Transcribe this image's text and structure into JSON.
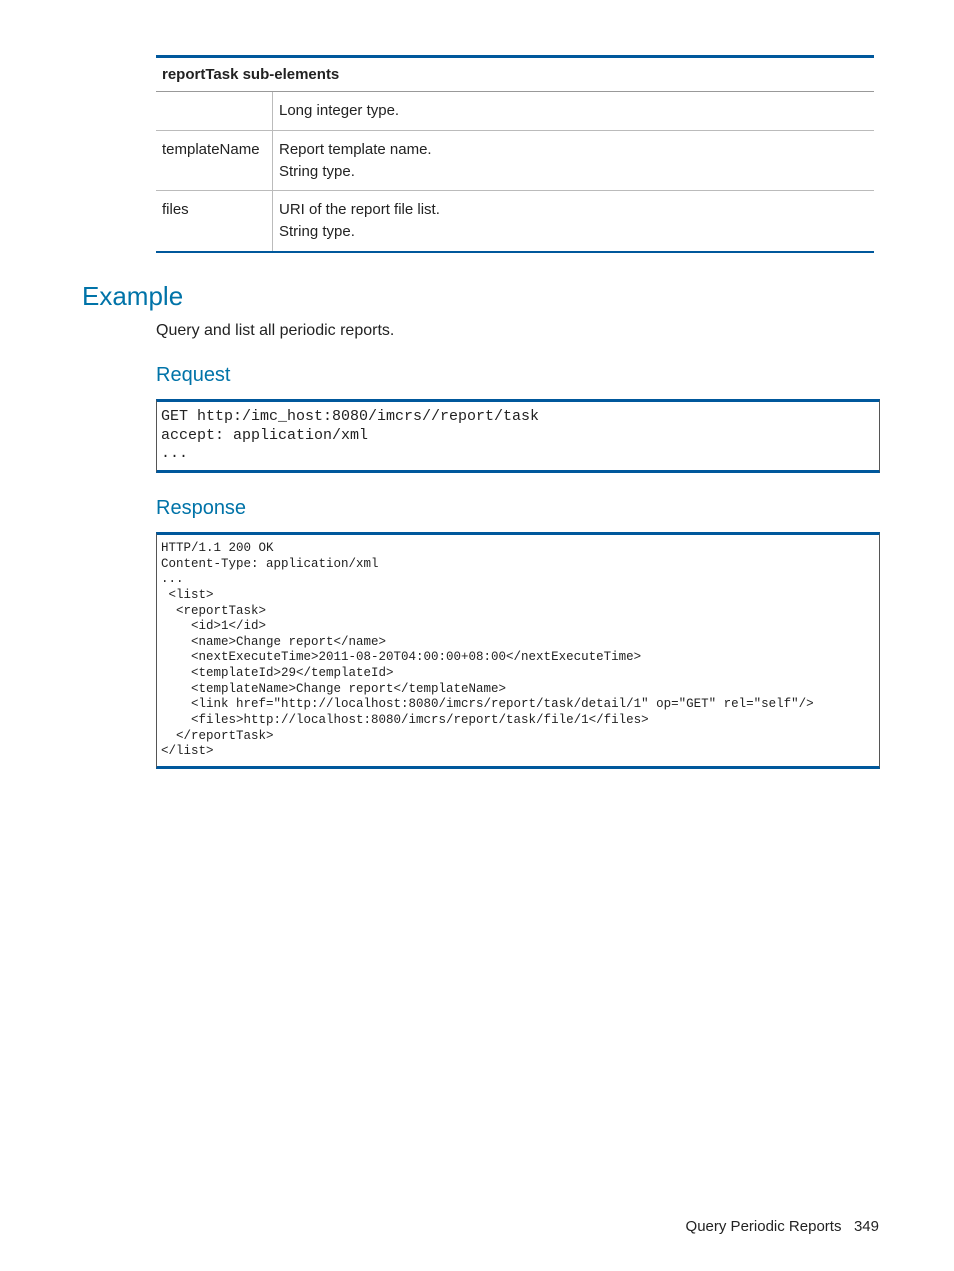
{
  "table": {
    "header": "reportTask sub-elements",
    "rows": [
      {
        "c1": "",
        "c2": "Long integer type."
      },
      {
        "c1": "templateName",
        "c2": "Report template name.\nString type."
      },
      {
        "c1": "files",
        "c2": "URI of the report file list.\nString type."
      }
    ]
  },
  "example": {
    "heading": "Example",
    "intro": "Query and list all periodic reports.",
    "request_heading": "Request",
    "request_code": "GET http:/imc_host:8080/imcrs//report/task\naccept: application/xml\n...",
    "response_heading": "Response",
    "response_code": "HTTP/1.1 200 OK\nContent-Type: application/xml\n...\n <list>\n  <reportTask>\n    <id>1</id>\n    <name>Change report</name>\n    <nextExecuteTime>2011-08-20T04:00:00+08:00</nextExecuteTime>\n    <templateId>29</templateId>\n    <templateName>Change report</templateName>\n    <link href=\"http://localhost:8080/imcrs/report/task/detail/1\" op=\"GET\" rel=\"self\"/>\n    <files>http://localhost:8080/imcrs/report/task/file/1</files>\n  </reportTask>\n</list>"
  },
  "footer": {
    "title": "Query Periodic Reports",
    "page": "349"
  }
}
